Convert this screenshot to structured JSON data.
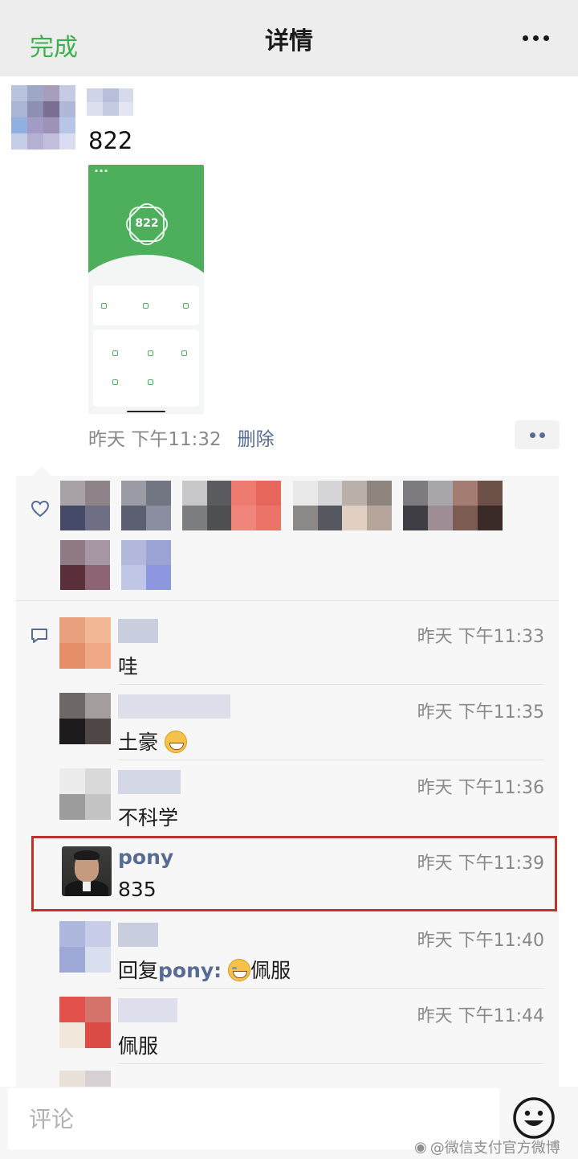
{
  "nav": {
    "done_label": "完成",
    "title": "详情"
  },
  "post": {
    "text": "822",
    "time": "昨天 下午11:32",
    "delete_label": "删除",
    "screenshot": {
      "score": "822",
      "accent": "#4dae5b"
    }
  },
  "comments": [
    {
      "time": "昨天 下午11:33",
      "text": "哇"
    },
    {
      "time": "昨天 下午11:35",
      "text": "土豪"
    },
    {
      "time": "昨天 下午11:36",
      "text": "不科学"
    },
    {
      "name": "pony",
      "time": "昨天 下午11:39",
      "text": "835"
    },
    {
      "reply_prefix": "回复",
      "reply_to": "pony:",
      "time": "昨天 下午11:40",
      "text": "佩服"
    },
    {
      "time": "昨天 下午11:44",
      "text": "佩服"
    }
  ],
  "input": {
    "placeholder": "评论"
  },
  "watermark": "@微信支付官方微博",
  "colors": {
    "accent_green": "#3cb04a",
    "link_blue": "#576b95",
    "highlight_red": "#c0302d"
  },
  "icons": {
    "more": "more-dots-icon",
    "like": "heart-icon",
    "comment": "comment-icon",
    "emoji": "smiley-icon"
  }
}
